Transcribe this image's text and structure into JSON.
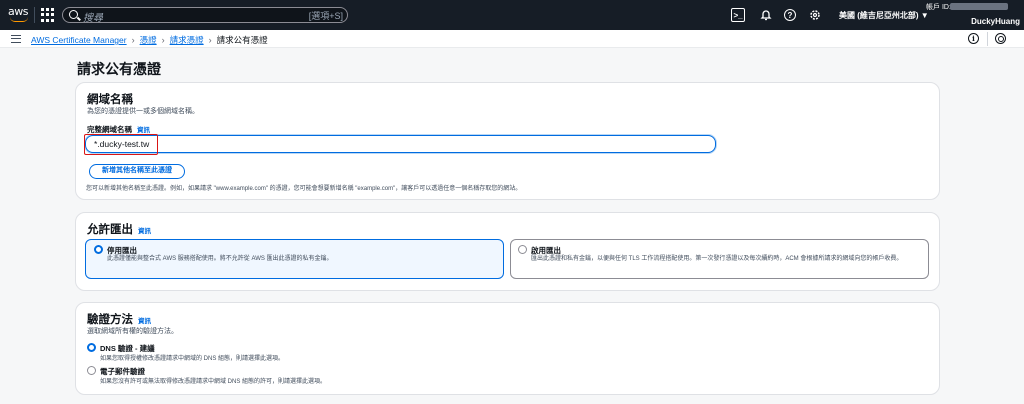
{
  "topnav": {
    "logo": "aws",
    "search_placeholder": "搜尋",
    "search_shortcut": "[選項+S]",
    "region": "美國 (維吉尼亞州北部) ▼",
    "account_label": "帳戶 ID:",
    "user": "DuckyHuang",
    "icons": [
      "grid-icon",
      "terminal-icon",
      "bell-icon",
      "help-icon",
      "gear-icon"
    ]
  },
  "breadcrumb": {
    "items": [
      "AWS Certificate Manager",
      "憑證",
      "請求憑證"
    ],
    "current": "請求公有憑證"
  },
  "page": {
    "title": "請求公有憑證"
  },
  "domain_section": {
    "title": "網域名稱",
    "description": "為您的憑證提供一或多個網域名稱。",
    "field_label": "完整網域名稱",
    "info": "資訊",
    "value": "*.ducky-test.tw",
    "add_button": "新增其他名稱至此憑證",
    "hint": "您可以新增其他名稱至此憑證。例如，如果請求 \"www.example.com\" 的憑證，您可能會想要新增名稱 \"example.com\"，讓客戶可以透過任意一個名稱存取您的網站。"
  },
  "export_section": {
    "title": "允許匯出",
    "info": "資訊",
    "options": [
      {
        "label": "停用匯出",
        "description": "此憑證僅能與整合式 AWS 服務搭配使用。將不允許從 AWS 匯出此憑證的私有金鑰。",
        "selected": true
      },
      {
        "label": "啟用匯出",
        "description": "匯出此憑證和私有金鑰，以便與任何 TLS 工作流程搭配使用。第一次發行憑證以及每次續約時，ACM 會根據所請求的網域向您的帳戶收費。",
        "selected": false
      }
    ]
  },
  "validation_section": {
    "title": "驗證方法",
    "info": "資訊",
    "description": "選取網域所有權的驗證方法。",
    "options": [
      {
        "label": "DNS 驗證 - 建議",
        "description": "如果您取得授權修改憑證請求中網域的 DNS 組態，則請選擇此選項。",
        "selected": true
      },
      {
        "label": "電子郵件驗證",
        "description": "如果您沒有許可或無法取得修改憑證請求中網域 DNS 組態的許可，則請選擇此選項。",
        "selected": false
      }
    ]
  }
}
